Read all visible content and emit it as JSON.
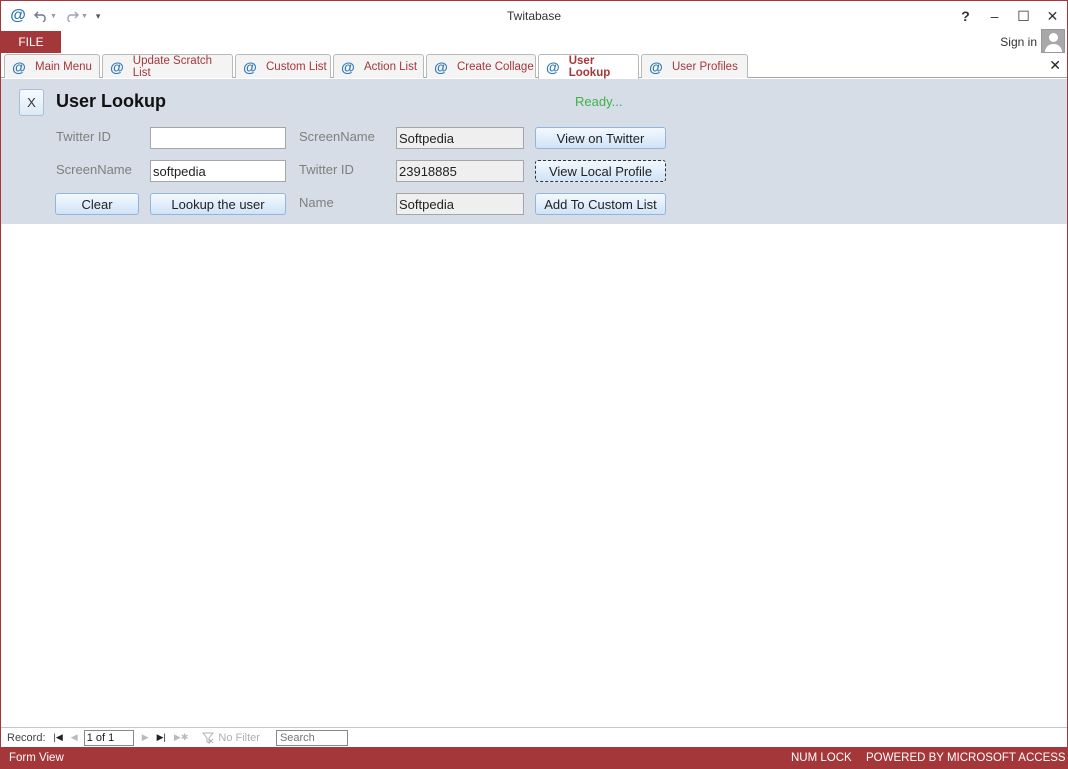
{
  "window": {
    "title": "Twitabase",
    "app_icon": "@",
    "help": "?",
    "minimize": "–",
    "maximize": "☐",
    "close": "✕"
  },
  "ribbon": {
    "file_label": "FILE",
    "signin_label": "Sign in"
  },
  "tabs": [
    {
      "label": "Main Menu",
      "active": false
    },
    {
      "label": "Update Scratch List",
      "active": false
    },
    {
      "label": "Custom List",
      "active": false
    },
    {
      "label": "Action List",
      "active": false
    },
    {
      "label": "Create Collage",
      "active": false
    },
    {
      "label": "User Lookup",
      "active": true
    },
    {
      "label": "User Profiles",
      "active": false
    }
  ],
  "form": {
    "close_label": "X",
    "title": "User Lookup",
    "status": "Ready...",
    "left": {
      "twitter_id_label": "Twitter ID",
      "twitter_id_value": "",
      "screenname_label": "ScreenName",
      "screenname_value": "softpedia",
      "clear_label": "Clear",
      "lookup_label": "Lookup the user"
    },
    "right": {
      "screenname_label": "ScreenName",
      "screenname_value": "Softpedia",
      "twitter_id_label": "Twitter ID",
      "twitter_id_value": "23918885",
      "name_label": "Name",
      "name_value": "Softpedia",
      "view_twitter_label": "View on Twitter",
      "view_local_label": "View Local Profile",
      "add_custom_label": "Add To Custom List"
    }
  },
  "record_nav": {
    "label": "Record:",
    "position": "1 of 1",
    "filter_label": "No Filter",
    "search_placeholder": "Search"
  },
  "statusbar": {
    "view": "Form View",
    "numlock": "NUM LOCK",
    "powered": "POWERED BY MICROSOFT ACCESS"
  },
  "colors": {
    "accent": "#a4373a",
    "header_bg": "#d6dde6",
    "status_green": "#3db34a"
  }
}
